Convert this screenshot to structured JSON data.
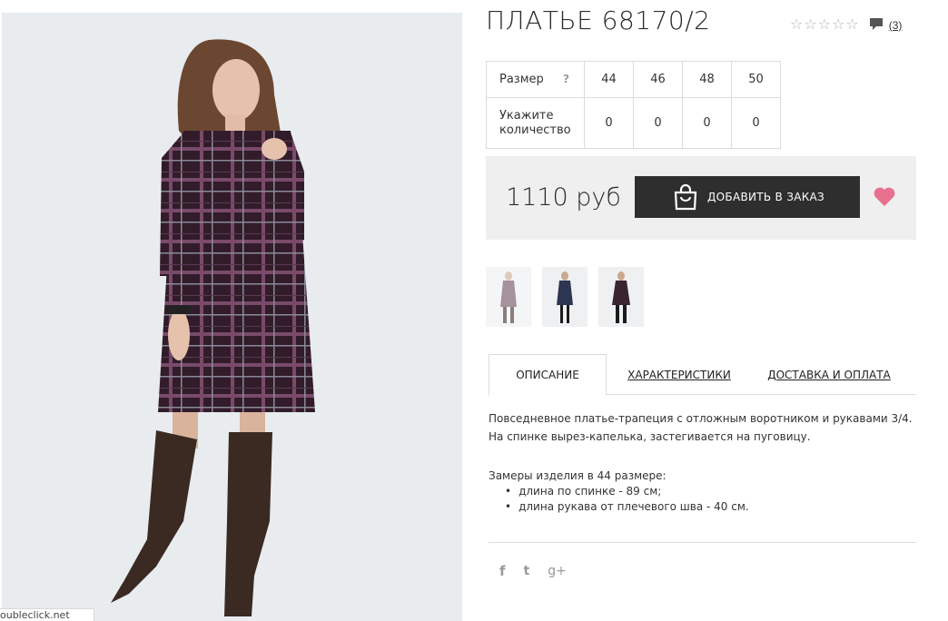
{
  "product": {
    "title": "ПЛАТЬЕ 68170/2",
    "review_count": "(3)",
    "rating_stars": 0,
    "rating_max": 5
  },
  "sizes": {
    "size_label": "Размер",
    "help_mark": "?",
    "qty_label": "Укажите количество",
    "values": [
      "44",
      "46",
      "48",
      "50"
    ],
    "quantities": [
      "0",
      "0",
      "0",
      "0"
    ]
  },
  "purchase": {
    "price": "1110 руб",
    "add_button_label": "ДОБАВИТЬ В ЗАКАЗ"
  },
  "tabs": {
    "description": "ОПИСАНИЕ",
    "characteristics": "ХАРАКТЕРИСТИКИ",
    "delivery": "ДОСТАВКА И ОПЛАТА"
  },
  "description": {
    "text": "Повседневное платье-трапеция с отложным воротником и рукавами 3/4. На спинке вырез-капелька, застегивается на пуговицу.",
    "measurements_title": "Замеры изделия в 44 размере:",
    "measurements": [
      "длина по спинке - 89 см;",
      "длина рукава от плечевого шва - 40 см."
    ]
  },
  "social": {
    "facebook": "f",
    "twitter": "t",
    "google": "g+"
  },
  "ad_strip": "oubleclick.net",
  "icons": {
    "star": "star-outline-icon",
    "comment": "comment-icon",
    "bag": "shopping-bag-icon",
    "heart": "heart-icon"
  },
  "colors": {
    "button_bg": "#2e2e2e",
    "price_box_bg": "#efefef",
    "heart": "#e8718f",
    "star": "#b5b5b5",
    "dress_plaid": "#3a2430",
    "boots": "#3b2a22"
  }
}
